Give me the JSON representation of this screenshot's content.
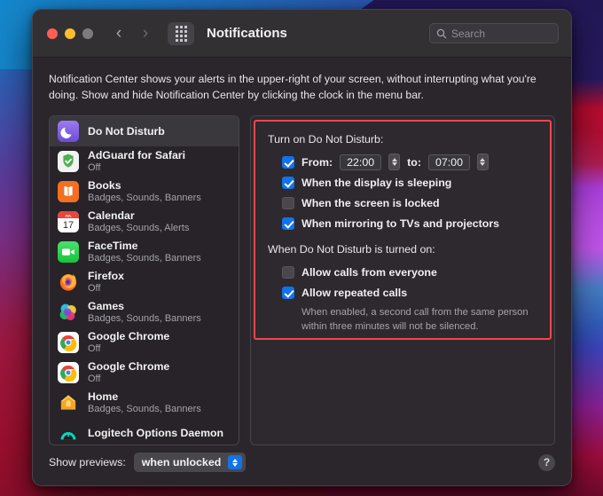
{
  "window": {
    "title": "Notifications",
    "traffic_lights": [
      "close",
      "minimize",
      "zoom"
    ],
    "back_icon": "chevron-left-icon",
    "forward_icon": "chevron-right-icon",
    "grid_icon": "show-all-grid-icon",
    "search": {
      "placeholder": "Search",
      "value": "",
      "icon": "search-icon"
    }
  },
  "blurb": "Notification Center shows your alerts in the upper-right of your screen, without interrupting what you're doing. Show and hide Notification Center by clicking the clock in the menu bar.",
  "applist": [
    {
      "name": "Do Not Disturb",
      "sub": "",
      "icon": "do-not-disturb-icon",
      "selected": true
    },
    {
      "name": "AdGuard for Safari",
      "sub": "Off",
      "icon": "adguard-icon",
      "selected": false
    },
    {
      "name": "Books",
      "sub": "Badges, Sounds, Banners",
      "icon": "books-icon",
      "selected": false
    },
    {
      "name": "Calendar",
      "sub": "Badges, Sounds, Alerts",
      "icon": "calendar-icon",
      "selected": false
    },
    {
      "name": "FaceTime",
      "sub": "Badges, Sounds, Banners",
      "icon": "facetime-icon",
      "selected": false
    },
    {
      "name": "Firefox",
      "sub": "Off",
      "icon": "firefox-icon",
      "selected": false
    },
    {
      "name": "Games",
      "sub": "Badges, Sounds, Banners",
      "icon": "games-icon",
      "selected": false
    },
    {
      "name": "Google Chrome",
      "sub": "Off",
      "icon": "chrome-icon",
      "selected": false
    },
    {
      "name": "Google Chrome",
      "sub": "Off",
      "icon": "chrome-icon",
      "selected": false
    },
    {
      "name": "Home",
      "sub": "Badges, Sounds, Banners",
      "icon": "home-icon",
      "selected": false
    },
    {
      "name": "Logitech Options Daemon",
      "sub": "",
      "icon": "logitech-icon",
      "selected": false
    }
  ],
  "detail": {
    "group1_label": "Turn on Do Not Disturb:",
    "group2_label": "When Do Not Disturb is turned on:",
    "schedule": {
      "checked": true,
      "from_label": "From:",
      "from_value": "22:00",
      "to_label": "to:",
      "to_value": "07:00"
    },
    "options": [
      {
        "label": "When the display is sleeping",
        "checked": true
      },
      {
        "label": "When the screen is locked",
        "checked": false
      },
      {
        "label": "When mirroring to TVs and projectors",
        "checked": true
      }
    ],
    "calls": [
      {
        "label": "Allow calls from everyone",
        "checked": false
      },
      {
        "label": "Allow repeated calls",
        "checked": true
      }
    ],
    "calls_help": "When enabled, a second call from the same person within three minutes will not be silenced.",
    "highlight_color": "#f4464c"
  },
  "footer": {
    "previews_label": "Show previews:",
    "previews_value": "when unlocked",
    "help_label": "?",
    "accent_color": "#1273ea"
  }
}
